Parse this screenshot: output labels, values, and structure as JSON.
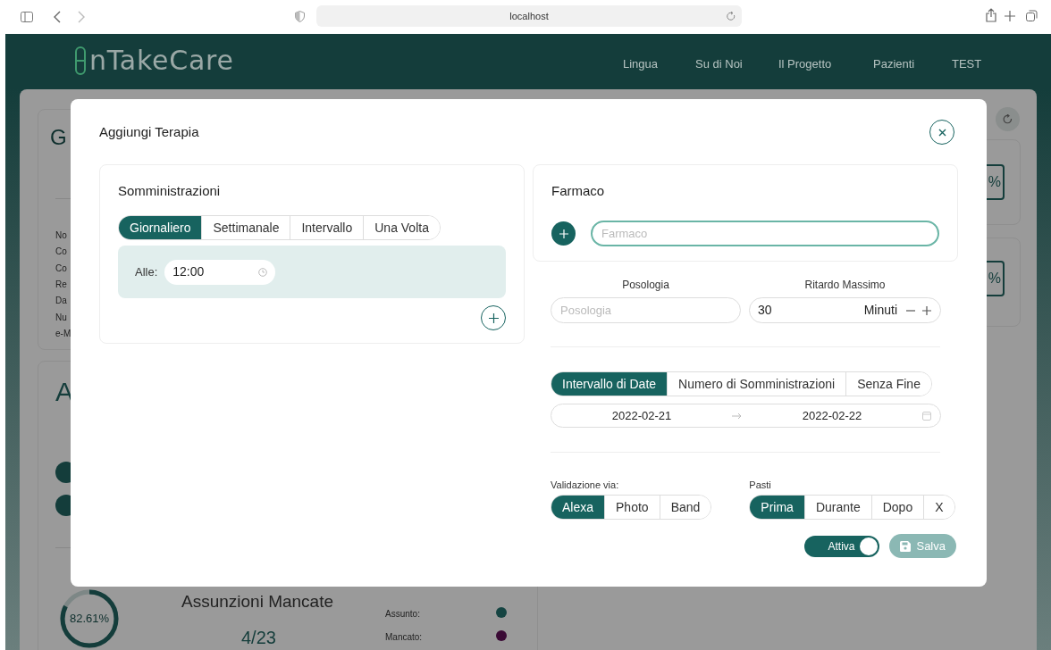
{
  "browser": {
    "url": "localhost"
  },
  "navbar": {
    "logo": "nTakeCare",
    "links": [
      "Lingua",
      "Su di Noi",
      "Il Progetto",
      "Pazienti",
      "TEST"
    ]
  },
  "background": {
    "card_1_title": "G",
    "info_labels": [
      "No",
      "Co",
      "Co",
      "Re",
      "Da",
      "Nu",
      "e-M"
    ],
    "card_2_title": "A",
    "donut": {
      "level": 0.8261,
      "label": "82.61%"
    },
    "stat_title": "Assunzioni Mancate",
    "stat_value": "4/23",
    "legend": [
      {
        "label": "Assunto:",
        "color": "#154442"
      },
      {
        "label": "Mancato:",
        "color": "#3a0a35"
      }
    ],
    "percent_badges": [
      "%",
      "%"
    ]
  },
  "modal": {
    "title": "Aggiungi Terapia",
    "schedule": {
      "title": "Somministrazioni",
      "tabs": [
        {
          "label": "Giornaliero",
          "selected": true
        },
        {
          "label": "Settimanale",
          "selected": false
        },
        {
          "label": "Intervallo",
          "selected": false
        },
        {
          "label": "Una Volta",
          "selected": false
        }
      ],
      "time_label": "Alle:",
      "time_value": "12:00"
    },
    "drug": {
      "title": "Farmaco",
      "placeholder": "Farmaco"
    },
    "dosage": {
      "label": "Posologia",
      "placeholder": "Posologia"
    },
    "max_delay": {
      "label": "Ritardo Massimo",
      "value": "30",
      "unit": "Minuti"
    },
    "duration_tabs": [
      {
        "label": "Intervallo di Date",
        "selected": true
      },
      {
        "label": "Numero di Somministrazioni",
        "selected": false
      },
      {
        "label": "Senza Fine",
        "selected": false
      }
    ],
    "date_range": {
      "start": "2022-02-21",
      "end": "2022-02-22"
    },
    "validation": {
      "label": "Validazione via:",
      "options": [
        {
          "label": "Alexa",
          "selected": true
        },
        {
          "label": "Photo",
          "selected": false
        },
        {
          "label": "Band",
          "selected": false
        }
      ]
    },
    "meals": {
      "label": "Pasti",
      "options": [
        {
          "label": "Prima",
          "selected": true
        },
        {
          "label": "Durante",
          "selected": false
        },
        {
          "label": "Dopo",
          "selected": false
        },
        {
          "label": "X",
          "selected": false
        }
      ]
    },
    "active_toggle": {
      "label": "Attiva",
      "on": true
    },
    "save_button": {
      "label": "Salva",
      "disabled": true
    }
  }
}
